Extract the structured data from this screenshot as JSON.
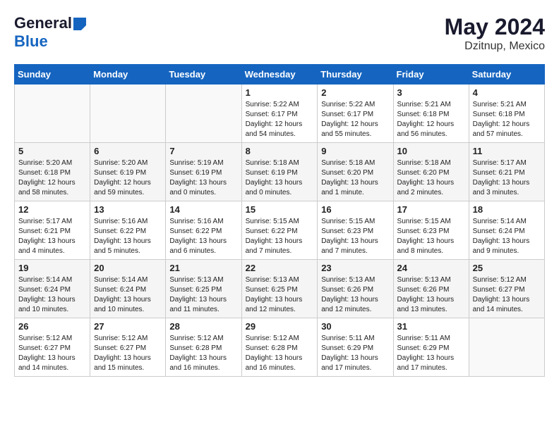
{
  "header": {
    "logo_general": "General",
    "logo_blue": "Blue",
    "month_year": "May 2024",
    "location": "Dzitnup, Mexico"
  },
  "days_of_week": [
    "Sunday",
    "Monday",
    "Tuesday",
    "Wednesday",
    "Thursday",
    "Friday",
    "Saturday"
  ],
  "weeks": [
    [
      {
        "day": "",
        "info": ""
      },
      {
        "day": "",
        "info": ""
      },
      {
        "day": "",
        "info": ""
      },
      {
        "day": "1",
        "info": "Sunrise: 5:22 AM\nSunset: 6:17 PM\nDaylight: 12 hours\nand 54 minutes."
      },
      {
        "day": "2",
        "info": "Sunrise: 5:22 AM\nSunset: 6:17 PM\nDaylight: 12 hours\nand 55 minutes."
      },
      {
        "day": "3",
        "info": "Sunrise: 5:21 AM\nSunset: 6:18 PM\nDaylight: 12 hours\nand 56 minutes."
      },
      {
        "day": "4",
        "info": "Sunrise: 5:21 AM\nSunset: 6:18 PM\nDaylight: 12 hours\nand 57 minutes."
      }
    ],
    [
      {
        "day": "5",
        "info": "Sunrise: 5:20 AM\nSunset: 6:18 PM\nDaylight: 12 hours\nand 58 minutes."
      },
      {
        "day": "6",
        "info": "Sunrise: 5:20 AM\nSunset: 6:19 PM\nDaylight: 12 hours\nand 59 minutes."
      },
      {
        "day": "7",
        "info": "Sunrise: 5:19 AM\nSunset: 6:19 PM\nDaylight: 13 hours\nand 0 minutes."
      },
      {
        "day": "8",
        "info": "Sunrise: 5:18 AM\nSunset: 6:19 PM\nDaylight: 13 hours\nand 0 minutes."
      },
      {
        "day": "9",
        "info": "Sunrise: 5:18 AM\nSunset: 6:20 PM\nDaylight: 13 hours\nand 1 minute."
      },
      {
        "day": "10",
        "info": "Sunrise: 5:18 AM\nSunset: 6:20 PM\nDaylight: 13 hours\nand 2 minutes."
      },
      {
        "day": "11",
        "info": "Sunrise: 5:17 AM\nSunset: 6:21 PM\nDaylight: 13 hours\nand 3 minutes."
      }
    ],
    [
      {
        "day": "12",
        "info": "Sunrise: 5:17 AM\nSunset: 6:21 PM\nDaylight: 13 hours\nand 4 minutes."
      },
      {
        "day": "13",
        "info": "Sunrise: 5:16 AM\nSunset: 6:22 PM\nDaylight: 13 hours\nand 5 minutes."
      },
      {
        "day": "14",
        "info": "Sunrise: 5:16 AM\nSunset: 6:22 PM\nDaylight: 13 hours\nand 6 minutes."
      },
      {
        "day": "15",
        "info": "Sunrise: 5:15 AM\nSunset: 6:22 PM\nDaylight: 13 hours\nand 7 minutes."
      },
      {
        "day": "16",
        "info": "Sunrise: 5:15 AM\nSunset: 6:23 PM\nDaylight: 13 hours\nand 7 minutes."
      },
      {
        "day": "17",
        "info": "Sunrise: 5:15 AM\nSunset: 6:23 PM\nDaylight: 13 hours\nand 8 minutes."
      },
      {
        "day": "18",
        "info": "Sunrise: 5:14 AM\nSunset: 6:24 PM\nDaylight: 13 hours\nand 9 minutes."
      }
    ],
    [
      {
        "day": "19",
        "info": "Sunrise: 5:14 AM\nSunset: 6:24 PM\nDaylight: 13 hours\nand 10 minutes."
      },
      {
        "day": "20",
        "info": "Sunrise: 5:14 AM\nSunset: 6:24 PM\nDaylight: 13 hours\nand 10 minutes."
      },
      {
        "day": "21",
        "info": "Sunrise: 5:13 AM\nSunset: 6:25 PM\nDaylight: 13 hours\nand 11 minutes."
      },
      {
        "day": "22",
        "info": "Sunrise: 5:13 AM\nSunset: 6:25 PM\nDaylight: 13 hours\nand 12 minutes."
      },
      {
        "day": "23",
        "info": "Sunrise: 5:13 AM\nSunset: 6:26 PM\nDaylight: 13 hours\nand 12 minutes."
      },
      {
        "day": "24",
        "info": "Sunrise: 5:13 AM\nSunset: 6:26 PM\nDaylight: 13 hours\nand 13 minutes."
      },
      {
        "day": "25",
        "info": "Sunrise: 5:12 AM\nSunset: 6:27 PM\nDaylight: 13 hours\nand 14 minutes."
      }
    ],
    [
      {
        "day": "26",
        "info": "Sunrise: 5:12 AM\nSunset: 6:27 PM\nDaylight: 13 hours\nand 14 minutes."
      },
      {
        "day": "27",
        "info": "Sunrise: 5:12 AM\nSunset: 6:27 PM\nDaylight: 13 hours\nand 15 minutes."
      },
      {
        "day": "28",
        "info": "Sunrise: 5:12 AM\nSunset: 6:28 PM\nDaylight: 13 hours\nand 16 minutes."
      },
      {
        "day": "29",
        "info": "Sunrise: 5:12 AM\nSunset: 6:28 PM\nDaylight: 13 hours\nand 16 minutes."
      },
      {
        "day": "30",
        "info": "Sunrise: 5:11 AM\nSunset: 6:29 PM\nDaylight: 13 hours\nand 17 minutes."
      },
      {
        "day": "31",
        "info": "Sunrise: 5:11 AM\nSunset: 6:29 PM\nDaylight: 13 hours\nand 17 minutes."
      },
      {
        "day": "",
        "info": ""
      }
    ]
  ]
}
